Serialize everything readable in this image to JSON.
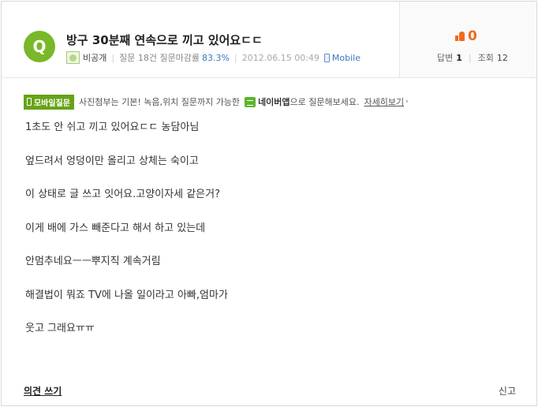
{
  "question": {
    "badge": "Q",
    "title": "방구 30분째 연속으로 끼고 있어요ㄷㄷ",
    "user": "비공개",
    "user_stats_label": "질문 18건 질문마감률",
    "close_rate": "83.3%",
    "date": "2012.06.15 00:49",
    "source": "Mobile"
  },
  "stats": {
    "likes": "0",
    "answers_label": "답변",
    "answers": "1",
    "views_label": "조회",
    "views": "12"
  },
  "notice": {
    "tag": "모바일질문",
    "text_before": "사진첨부는 기본! 녹음,위치 질문까지 가능한",
    "app_name": "네이버앱",
    "text_after": "으로 질문해보세요.",
    "more_link": "자세히보기",
    "more_arrow": "›"
  },
  "body_lines": [
    "1초도 안 쉬고 끼고 있어요ㄷㄷ 농담아님",
    "엎드려서 엉덩이만 올리고 상체는 숙이고",
    "이 상태로 글 쓰고 잇어요.고양이자세 같은거?",
    "이게 배에 가스 빼준다고 해서 하고 있는데",
    "안멈추네요ㅡㅡ뿌지직 계속거림",
    "해결법이 뭐죠 TV에 나올 일이라고 아빠,엄마가",
    "웃고 그래요ㅠㅠ"
  ],
  "footer": {
    "opinion_link": "의견 쓰기",
    "report_link": "신고"
  },
  "colors": {
    "accent_green": "#79b829",
    "like_orange": "#f06a1d",
    "link_blue": "#3a77c2"
  }
}
